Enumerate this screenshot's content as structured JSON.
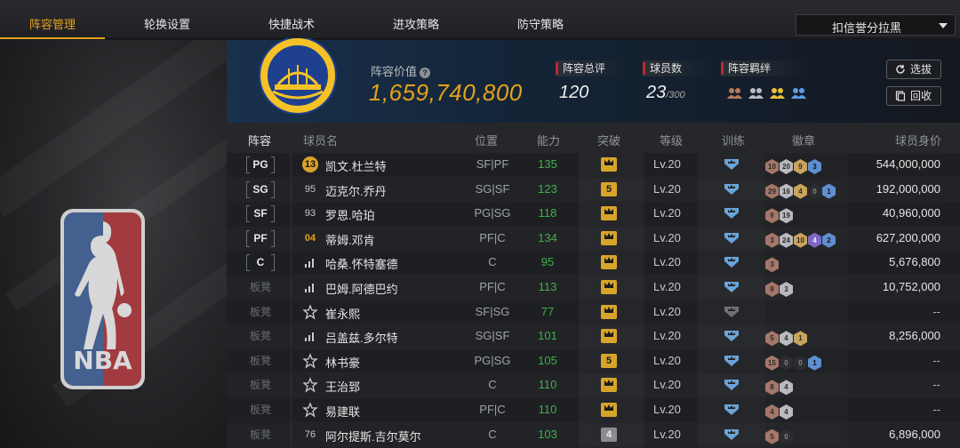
{
  "tabs": [
    {
      "label": "阵容管理",
      "active": true
    },
    {
      "label": "轮换设置",
      "active": false
    },
    {
      "label": "快捷战术",
      "active": false
    },
    {
      "label": "进攻策略",
      "active": false
    },
    {
      "label": "防守策略",
      "active": false
    }
  ],
  "filter_select": {
    "value": "扣信誉分拉黑"
  },
  "left_panel": {
    "logo_text": "NBA"
  },
  "team": {
    "value_label": "阵容价值",
    "value": "1,659,740,800",
    "rating_label": "阵容总评",
    "rating": "120",
    "player_count_label": "球员数",
    "player_count": "23",
    "player_max": "/300",
    "bonds_label": "阵容羁绊",
    "bond_icons": [
      "bond-bronze-icon",
      "bond-silver-icon",
      "bond-gold-icon",
      "bond-blue-icon"
    ]
  },
  "buttons": {
    "pick": "选拔",
    "recycle": "回收"
  },
  "table": {
    "headers": {
      "lineup": "阵容",
      "name": "球员名",
      "position": "位置",
      "power": "能力",
      "breakthrough": "突破",
      "level": "等级",
      "training": "训练",
      "badges": "徽章",
      "value": "球员身价"
    },
    "rows": [
      {
        "slot": "PG",
        "starter": true,
        "jersey": "13",
        "jersey_style": "gold",
        "name": "凯文.杜兰特",
        "position": "SF|PF",
        "power": "135",
        "break": "crown",
        "level": "Lv.20",
        "training": "blue",
        "badges": [
          {
            "t": "bronze",
            "v": "10"
          },
          {
            "t": "silver",
            "v": "20"
          },
          {
            "t": "gold",
            "v": "9"
          },
          {
            "t": "blue",
            "v": "3"
          }
        ],
        "value": "544,000,000"
      },
      {
        "slot": "SG",
        "starter": true,
        "jersey": "95",
        "jersey_style": "plain",
        "name": "迈克尔.乔丹",
        "position": "SG|SF",
        "power": "123",
        "break": "5",
        "level": "Lv.20",
        "training": "blue",
        "badges": [
          {
            "t": "bronze",
            "v": "29"
          },
          {
            "t": "silver",
            "v": "16"
          },
          {
            "t": "gold",
            "v": "4"
          },
          {
            "t": "black",
            "v": "0"
          },
          {
            "t": "blue",
            "v": "1"
          }
        ],
        "value": "192,000,000"
      },
      {
        "slot": "SF",
        "starter": true,
        "jersey": "93",
        "jersey_style": "plain",
        "name": "罗恩.哈珀",
        "position": "PG|SG",
        "power": "118",
        "break": "crown",
        "level": "Lv.20",
        "training": "blue",
        "badges": [
          {
            "t": "bronze",
            "v": "9"
          },
          {
            "t": "silver",
            "v": "19"
          }
        ],
        "value": "40,960,000"
      },
      {
        "slot": "PF",
        "starter": true,
        "jersey": "04",
        "jersey_style": "goldtxt",
        "name": "蒂姆.邓肯",
        "position": "PF|C",
        "power": "134",
        "break": "crown",
        "level": "Lv.20",
        "training": "blue",
        "badges": [
          {
            "t": "bronze",
            "v": "3"
          },
          {
            "t": "silver",
            "v": "24"
          },
          {
            "t": "gold",
            "v": "10"
          },
          {
            "t": "purple",
            "v": "4"
          },
          {
            "t": "blue",
            "v": "2"
          }
        ],
        "value": "627,200,000"
      },
      {
        "slot": "C",
        "starter": true,
        "jersey": "signal",
        "jersey_style": "icon",
        "name": "哈桑.怀特塞德",
        "position": "C",
        "power": "95",
        "break": "crown",
        "level": "Lv.20",
        "training": "blue",
        "badges": [
          {
            "t": "bronze",
            "v": "3"
          }
        ],
        "value": "5,676,800"
      },
      {
        "slot": "板凳",
        "starter": false,
        "jersey": "signal",
        "jersey_style": "icon",
        "name": "巴姆.阿德巴约",
        "position": "PF|C",
        "power": "113",
        "break": "crown",
        "level": "Lv.20",
        "training": "blue",
        "badges": [
          {
            "t": "bronze",
            "v": "9"
          },
          {
            "t": "silver",
            "v": "3"
          }
        ],
        "value": "10,752,000"
      },
      {
        "slot": "板凳",
        "starter": false,
        "jersey": "star",
        "jersey_style": "icon",
        "name": "崔永熙",
        "position": "SF|SG",
        "power": "77",
        "break": "crown",
        "level": "Lv.20",
        "training": "grey",
        "badges": [],
        "value": "--"
      },
      {
        "slot": "板凳",
        "starter": false,
        "jersey": "signal",
        "jersey_style": "icon",
        "name": "吕盖兹.多尔特",
        "position": "SG|SF",
        "power": "101",
        "break": "crown",
        "level": "Lv.20",
        "training": "blue",
        "badges": [
          {
            "t": "bronze",
            "v": "5"
          },
          {
            "t": "silver",
            "v": "4"
          },
          {
            "t": "gold",
            "v": "1"
          }
        ],
        "value": "8,256,000"
      },
      {
        "slot": "板凳",
        "starter": false,
        "jersey": "star",
        "jersey_style": "icon",
        "name": "林书豪",
        "position": "PG|SG",
        "power": "105",
        "break": "5",
        "level": "Lv.20",
        "training": "blue",
        "badges": [
          {
            "t": "bronze",
            "v": "15"
          },
          {
            "t": "black",
            "v": "0"
          },
          {
            "t": "black",
            "v": "0"
          },
          {
            "t": "blue",
            "v": "1"
          }
        ],
        "value": "--"
      },
      {
        "slot": "板凳",
        "starter": false,
        "jersey": "star",
        "jersey_style": "icon",
        "name": "王治郅",
        "position": "C",
        "power": "110",
        "break": "crown",
        "level": "Lv.20",
        "training": "blue",
        "badges": [
          {
            "t": "bronze",
            "v": "8"
          },
          {
            "t": "silver",
            "v": "4"
          }
        ],
        "value": "--"
      },
      {
        "slot": "板凳",
        "starter": false,
        "jersey": "star",
        "jersey_style": "icon",
        "name": "易建联",
        "position": "PF|C",
        "power": "110",
        "break": "crown",
        "level": "Lv.20",
        "training": "blue",
        "badges": [
          {
            "t": "bronze",
            "v": "4"
          },
          {
            "t": "silver",
            "v": "4"
          }
        ],
        "value": "--"
      },
      {
        "slot": "板凳",
        "starter": false,
        "jersey": "76",
        "jersey_style": "plain",
        "name": "阿尔提斯.吉尔莫尔",
        "position": "C",
        "power": "103",
        "break": "4",
        "level": "Lv.20",
        "training": "blue",
        "badges": [
          {
            "t": "bronze",
            "v": "5"
          },
          {
            "t": "black",
            "v": "0"
          }
        ],
        "value": "6,896,000"
      }
    ]
  }
}
